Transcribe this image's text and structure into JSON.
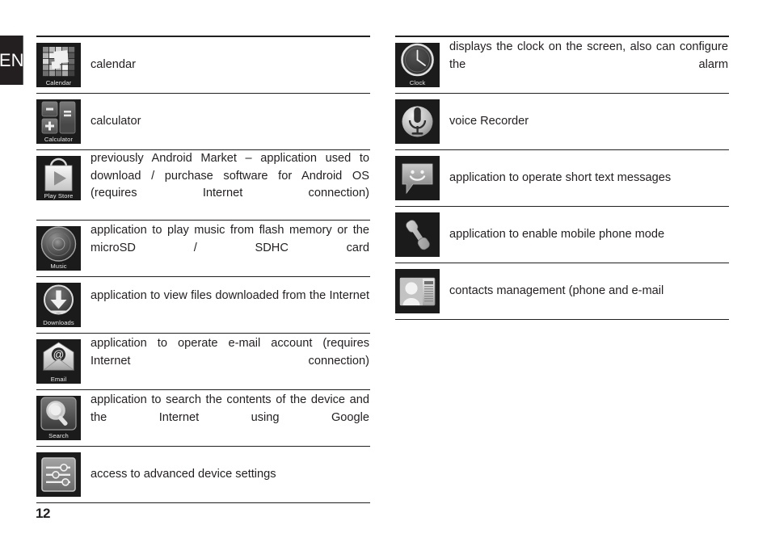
{
  "language_tab": {
    "label": "EN"
  },
  "page_number": "12",
  "columns": {
    "left": {
      "rows": [
        {
          "icon": "calendar-icon",
          "icon_label": "Calendar",
          "description": "calendar",
          "justified": false
        },
        {
          "icon": "calculator-icon",
          "icon_label": "Calculator",
          "description": "calculator",
          "justified": false
        },
        {
          "icon": "play-store-icon",
          "icon_label": "Play Store",
          "description": "previously Android Market – application used to download / purchase software for Android OS (requires Internet connection)",
          "justified": true
        },
        {
          "icon": "music-icon",
          "icon_label": "Music",
          "description": "application to play music from flash memory or the microSD / SDHC card",
          "justified": true
        },
        {
          "icon": "downloads-icon",
          "icon_label": "Downloads",
          "description": "application to view files downloaded from the Internet",
          "justified": true
        },
        {
          "icon": "email-icon",
          "icon_label": "Email",
          "description": "application to operate e-mail account (requires Internet connection)",
          "justified": true
        },
        {
          "icon": "search-icon",
          "icon_label": "Search",
          "description": "application to search the contents of the device and the Internet using Google",
          "justified": true
        },
        {
          "icon": "settings-icon",
          "icon_label": "",
          "description": "access to advanced device settings",
          "justified": false
        }
      ]
    },
    "right": {
      "rows": [
        {
          "icon": "clock-icon",
          "icon_label": "Clock",
          "description": "displays the clock on the screen, also can configure the alarm",
          "justified": true
        },
        {
          "icon": "voice-recorder-icon",
          "icon_label": "",
          "description": "voice Recorder",
          "justified": false
        },
        {
          "icon": "messaging-icon",
          "icon_label": "",
          "description": "application to operate short text messages",
          "justified": false
        },
        {
          "icon": "phone-icon",
          "icon_label": "",
          "description": "application to enable mobile phone mode",
          "justified": false
        },
        {
          "icon": "contacts-icon",
          "icon_label": "",
          "description": "contacts management (phone and e-mail",
          "justified": false
        }
      ]
    }
  },
  "colors": {
    "ink": "#231f20",
    "tile_background": "#1b1b1b",
    "tile_label": "#e8e8e8"
  }
}
